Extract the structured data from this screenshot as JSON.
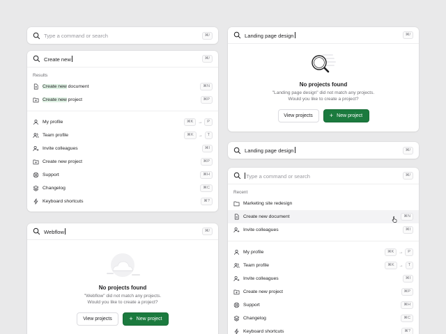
{
  "shortcut_open": "⌘/",
  "placeholder": "Type a command or search",
  "panel1": {
    "search": {
      "placeholder": "Type a command or search",
      "shortcut": "⌘/"
    }
  },
  "panel2": {
    "search": {
      "value": "Create new",
      "shortcut": "⌘/"
    },
    "results_label": "Results",
    "results": [
      {
        "highlight": "Create new",
        "rest": " document",
        "shortcut": "⌘N",
        "icon": "document-icon"
      },
      {
        "highlight": "Create new",
        "rest": " project",
        "shortcut": "⌘P",
        "icon": "folder-plus-icon"
      }
    ],
    "commands": [
      {
        "label": "My profile",
        "keys": [
          "⌘K",
          "P"
        ],
        "icon": "user-icon"
      },
      {
        "label": "Team profile",
        "keys": [
          "⌘K",
          "T"
        ],
        "icon": "users-icon"
      },
      {
        "label": "Invite colleagues",
        "keys": [
          "⌘I"
        ],
        "icon": "user-plus-icon"
      },
      {
        "label": "Create new project",
        "keys": [
          "⌘P"
        ],
        "icon": "folder-plus-icon"
      },
      {
        "label": "Support",
        "keys": [
          "⌘H"
        ],
        "icon": "support-icon"
      },
      {
        "label": "Changelog",
        "keys": [
          "⌘C"
        ],
        "icon": "layers-icon"
      },
      {
        "label": "Keyboard shortcuts",
        "keys": [
          "⌘?"
        ],
        "icon": "lightning-icon"
      }
    ]
  },
  "panel3": {
    "search": {
      "value": "Webflow",
      "shortcut": "⌘/"
    },
    "empty": {
      "title": "No projects found",
      "desc_line1": "\"Webflow\" did not match any projects.",
      "desc_line2": "Would you like to create a project?",
      "secondary": "View projects",
      "primary": "New project"
    }
  },
  "panel4": {
    "search": {
      "value": "Landing page design",
      "shortcut": "⌘/"
    },
    "empty": {
      "title": "No projects found",
      "desc_line1": "\"Landing page design\" did not match any projects.",
      "desc_line2": "Would you like to create a project?",
      "secondary": "View projects",
      "primary": "New project"
    }
  },
  "panel5": {
    "search": {
      "value": "Landing page design",
      "shortcut": "⌘/"
    }
  },
  "panel6": {
    "search": {
      "placeholder": "Type a command or search",
      "shortcut": "⌘/"
    },
    "recent_label": "Recent",
    "recent": [
      {
        "label": "Marketing site redesign",
        "shortcut": "",
        "icon": "folder-icon"
      },
      {
        "label": "Create new document",
        "shortcut": "⌘N",
        "icon": "document-icon"
      },
      {
        "label": "Invite colleagues",
        "shortcut": "⌘I",
        "icon": "user-plus-icon"
      }
    ],
    "commands": [
      {
        "label": "My profile",
        "keys": [
          "⌘K",
          "P"
        ],
        "icon": "user-icon"
      },
      {
        "label": "Team profile",
        "keys": [
          "⌘K",
          "T"
        ],
        "icon": "users-icon"
      },
      {
        "label": "Invite colleagues",
        "keys": [
          "⌘I"
        ],
        "icon": "user-plus-icon"
      },
      {
        "label": "Create new project",
        "keys": [
          "⌘P"
        ],
        "icon": "folder-plus-icon"
      },
      {
        "label": "Support",
        "keys": [
          "⌘H"
        ],
        "icon": "support-icon"
      },
      {
        "label": "Changelog",
        "keys": [
          "⌘C"
        ],
        "icon": "layers-icon"
      },
      {
        "label": "Keyboard shortcuts",
        "keys": [
          "⌘?"
        ],
        "icon": "lightning-icon"
      }
    ]
  },
  "colors": {
    "accent": "#1b7a3e",
    "highlight": "#dff2e4",
    "background": "#e9e9ea"
  }
}
